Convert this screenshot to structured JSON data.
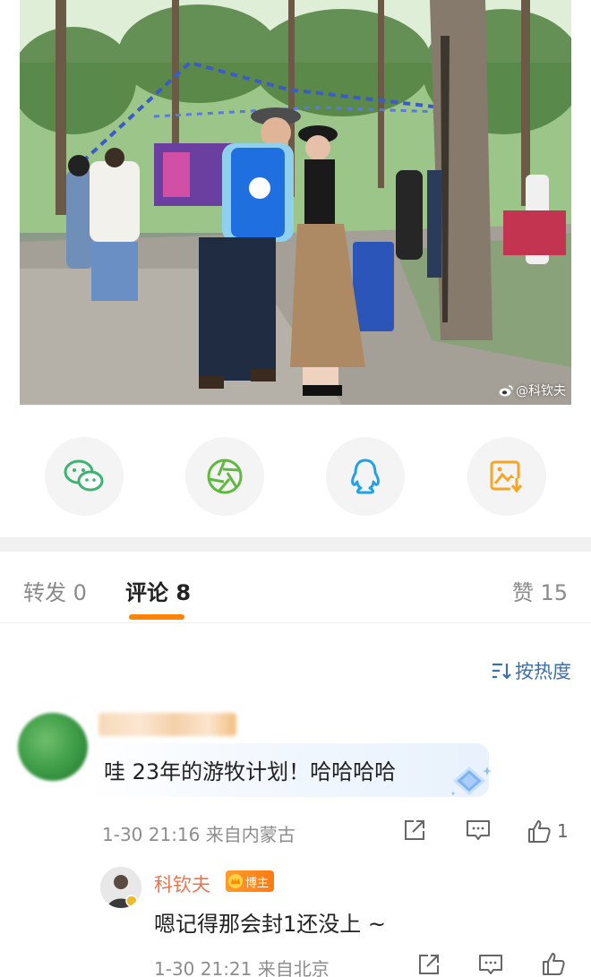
{
  "photo": {
    "watermark": "@科钦夫"
  },
  "share": [
    {
      "icon": "wechat-icon",
      "color": "#3cb371"
    },
    {
      "icon": "moments-icon",
      "color": "#5fb840"
    },
    {
      "icon": "qq-icon",
      "color": "#1fa2e8"
    },
    {
      "icon": "save-image-icon",
      "color": "#f5a623"
    }
  ],
  "tabs": {
    "repost": "转发 0",
    "comments": "评论 8",
    "likes": "赞 15"
  },
  "sort_label": "按热度",
  "comments": [
    {
      "text": "哇 23年的游牧计划！哈哈哈哈",
      "meta": "1-30 21:16  来自内蒙古",
      "like_count": "1",
      "reply": {
        "author": "科钦夫",
        "badge": "博主",
        "text": "嗯记得那会封1还没上 ~",
        "meta": "1-30 21:21  来自北京"
      }
    }
  ],
  "colors": {
    "accent": "#ff8200",
    "link": "#3d6ea8",
    "author": "#eb7350"
  }
}
